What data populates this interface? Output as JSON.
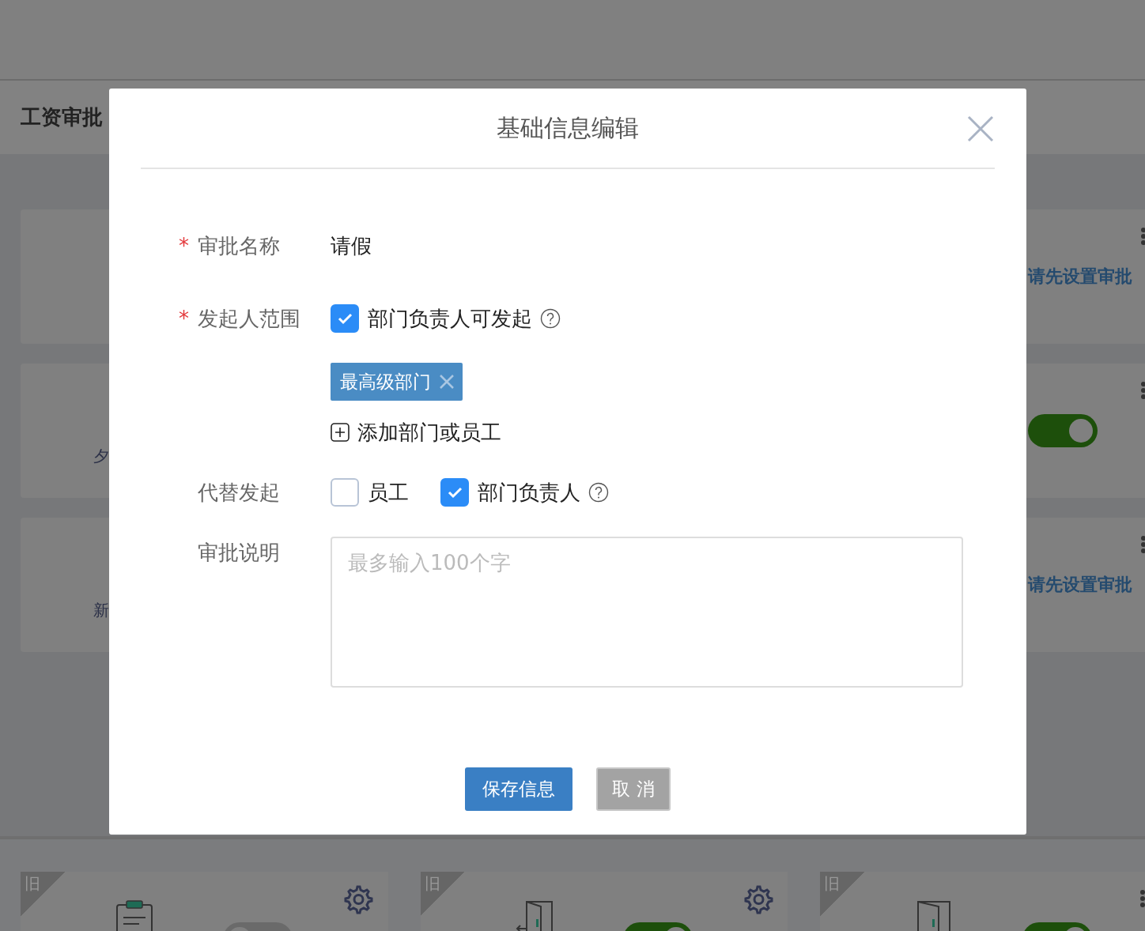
{
  "page": {
    "title": "工资审批",
    "card_rows": [
      {
        "right": {
          "kind": "note",
          "text": "请先设置审批"
        }
      },
      {
        "left_text": "夕",
        "right": {
          "kind": "toggle",
          "on": true
        }
      },
      {
        "left_text": "新",
        "right": {
          "kind": "note",
          "text": "请先设置审批"
        }
      }
    ],
    "bottom_cards": [
      {
        "badge": "旧",
        "on": false,
        "kind": "settings"
      },
      {
        "badge": "旧",
        "on": true,
        "kind": "settings"
      },
      {
        "badge": "旧",
        "on": true,
        "kind": "menu"
      }
    ]
  },
  "dialog": {
    "title": "基础信息编辑",
    "fields": [
      {
        "kind": "text",
        "label": "审批名称",
        "marker": "*",
        "value": "请假"
      },
      {
        "kind": "scope",
        "label": "发起人范围",
        "marker": "*",
        "checkbox": {
          "label": "部门负责人可发起",
          "checked": true,
          "help": true
        },
        "tags": [
          {
            "label": "最高级部门"
          }
        ],
        "add_label": "添加部门或员工"
      },
      {
        "kind": "checks",
        "label": "代替发起",
        "options": [
          {
            "label": "员工",
            "checked": false,
            "help": false
          },
          {
            "label": "部门负责人",
            "checked": true,
            "help": true
          }
        ]
      },
      {
        "kind": "textarea",
        "label": "审批说明",
        "placeholder": "最多输入100个字"
      }
    ],
    "buttons": [
      {
        "kind": "primary",
        "label": "保存信息"
      },
      {
        "kind": "secondary",
        "label": "取 消"
      }
    ]
  }
}
